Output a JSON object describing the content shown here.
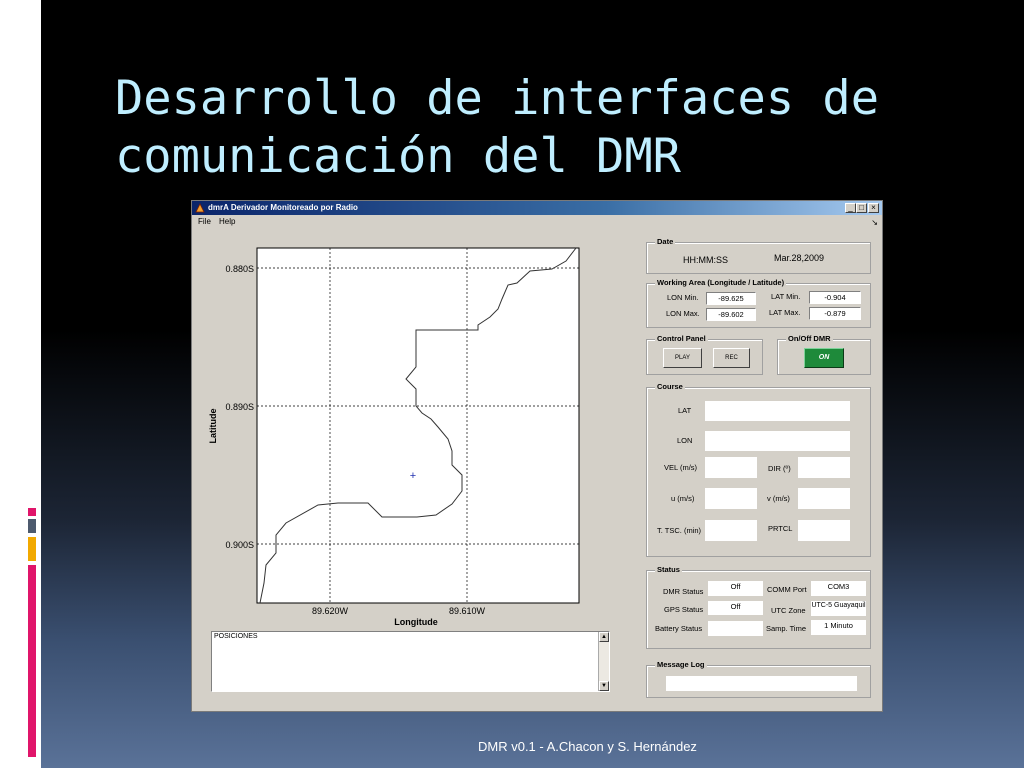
{
  "slide": {
    "title": "Desarrollo de interfaces de comunicación del DMR",
    "footer": "DMR v0.1 - A.Chacon y S. Hernández"
  },
  "window": {
    "title": "dmrA Derivador Monitoreado por Radio",
    "menu": [
      "File",
      "Help"
    ]
  },
  "plot": {
    "ylabel": "Latitude",
    "xlabel": "Longitude",
    "yticks": [
      "0.880S",
      "0.890S",
      "0.900S"
    ],
    "xticks": [
      "89.620W",
      "89.610W"
    ]
  },
  "positions": {
    "label": "POSICIONES"
  },
  "date_panel": {
    "title": "Date",
    "time": "HH:MM:SS",
    "date": "Mar.28,2009"
  },
  "working_area": {
    "title": "Working Area (Longitude / Latitude)",
    "lon_min_label": "LON Min.",
    "lon_min": "-89.625",
    "lon_max_label": "LON Max.",
    "lon_max": "-89.602",
    "lat_min_label": "LAT Min.",
    "lat_min": "-0.904",
    "lat_max_label": "LAT Max.",
    "lat_max": "-0.879"
  },
  "control_panel": {
    "title": "Control Panel",
    "play": "PLAY",
    "rec": "REC"
  },
  "onoff": {
    "title": "On/Off DMR",
    "button": "ON"
  },
  "course": {
    "title": "Course",
    "lat": "LAT",
    "lon": "LON",
    "vel": "VEL (m/s)",
    "dir": "DIR (º)",
    "u": "u (m/s)",
    "v": "v (m/s)",
    "tsc": "T. TSC. (min)",
    "prtcl": "PRTCL"
  },
  "status": {
    "title": "Status",
    "dmr_status_label": "DMR Status",
    "dmr_status": "Off",
    "gps_status_label": "GPS Status",
    "gps_status": "Off",
    "battery_label": "Battery Status",
    "comm_port_label": "COMM Port",
    "comm_port": "COM3",
    "utc_zone_label": "UTC Zone",
    "utc_zone": "UTC-5 Guayaquil",
    "samp_time_label": "Samp. Time",
    "samp_time": "1 Minuto"
  },
  "message_log": {
    "title": "Message Log"
  },
  "colors": {
    "title_text": "#bfeeff",
    "on_button": "#1e8a3a",
    "deco_red": "#e0156a",
    "deco_orange": "#f2a900",
    "deco_slate": "#4d5a6e"
  }
}
